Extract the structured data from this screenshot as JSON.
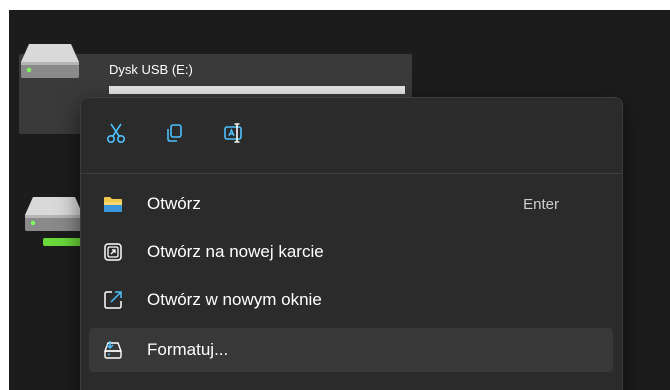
{
  "drive": {
    "label": "Dysk USB (E:)"
  },
  "quick_actions": {
    "cut_icon": "cut-icon",
    "copy_icon": "copy-icon",
    "rename_icon": "rename-icon"
  },
  "menu": {
    "items": [
      {
        "label": "Otwórz",
        "shortcut": "Enter",
        "icon": "folder-icon"
      },
      {
        "label": "Otwórz na nowej karcie",
        "shortcut": "",
        "icon": "open-new-tab-icon"
      },
      {
        "label": "Otwórz w nowym oknie",
        "shortcut": "",
        "icon": "open-new-window-icon"
      },
      {
        "label": "Formatuj...",
        "shortcut": "",
        "icon": "format-drive-icon"
      }
    ]
  },
  "colors": {
    "accent": "#4cc2ff",
    "folder": "#f2c94c",
    "usage_green": "#6ad93a",
    "menu_bg": "#2b2b2b",
    "hover_bg": "#383838"
  }
}
